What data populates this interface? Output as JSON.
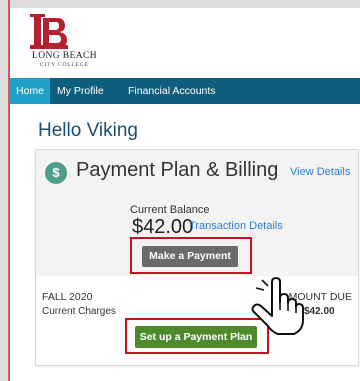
{
  "header": {
    "logo_text": "LONG BEACH",
    "logo_subtext": "CITY COLLEGE"
  },
  "nav": {
    "home": "Home",
    "profile": "My Profile",
    "financial": "Financial Accounts"
  },
  "greeting": "Hello Viking",
  "card": {
    "icon": "dollar-icon",
    "title": "Payment Plan & Billing",
    "view_details": "View Details",
    "balance_label": "Current Balance",
    "balance_amount": "$42.00",
    "transaction_details": "Transaction Details",
    "pay_button": "Make a Payment",
    "term": "FALL 2020",
    "charges_label": "Current Charges",
    "amount_due_label": "AMOUNT DUE",
    "amount_due": "$42.00",
    "plan_button": "Set up a Payment Plan"
  },
  "colors": {
    "nav_bg": "#0e5f7f",
    "nav_active": "#1fa0c8",
    "link": "#2a7fd4",
    "highlight": "#c4151c",
    "pay_button": "#6a6a6a",
    "plan_button": "#4e8a2c",
    "icon_bg": "#4f9e8c",
    "brand_red": "#b7202e"
  }
}
